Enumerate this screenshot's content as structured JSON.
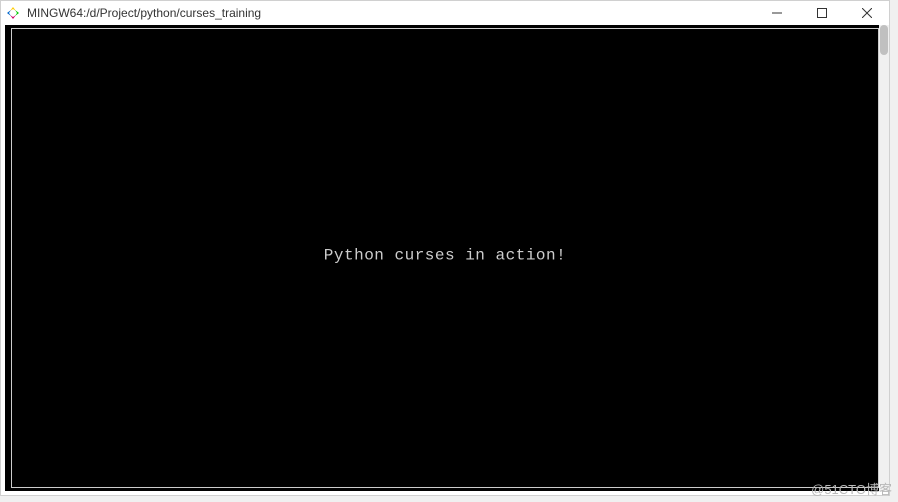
{
  "window": {
    "title": "MINGW64:/d/Project/python/curses_training"
  },
  "terminal": {
    "message": "Python curses in action!"
  },
  "watermark": {
    "text": "@51CTO博客"
  }
}
